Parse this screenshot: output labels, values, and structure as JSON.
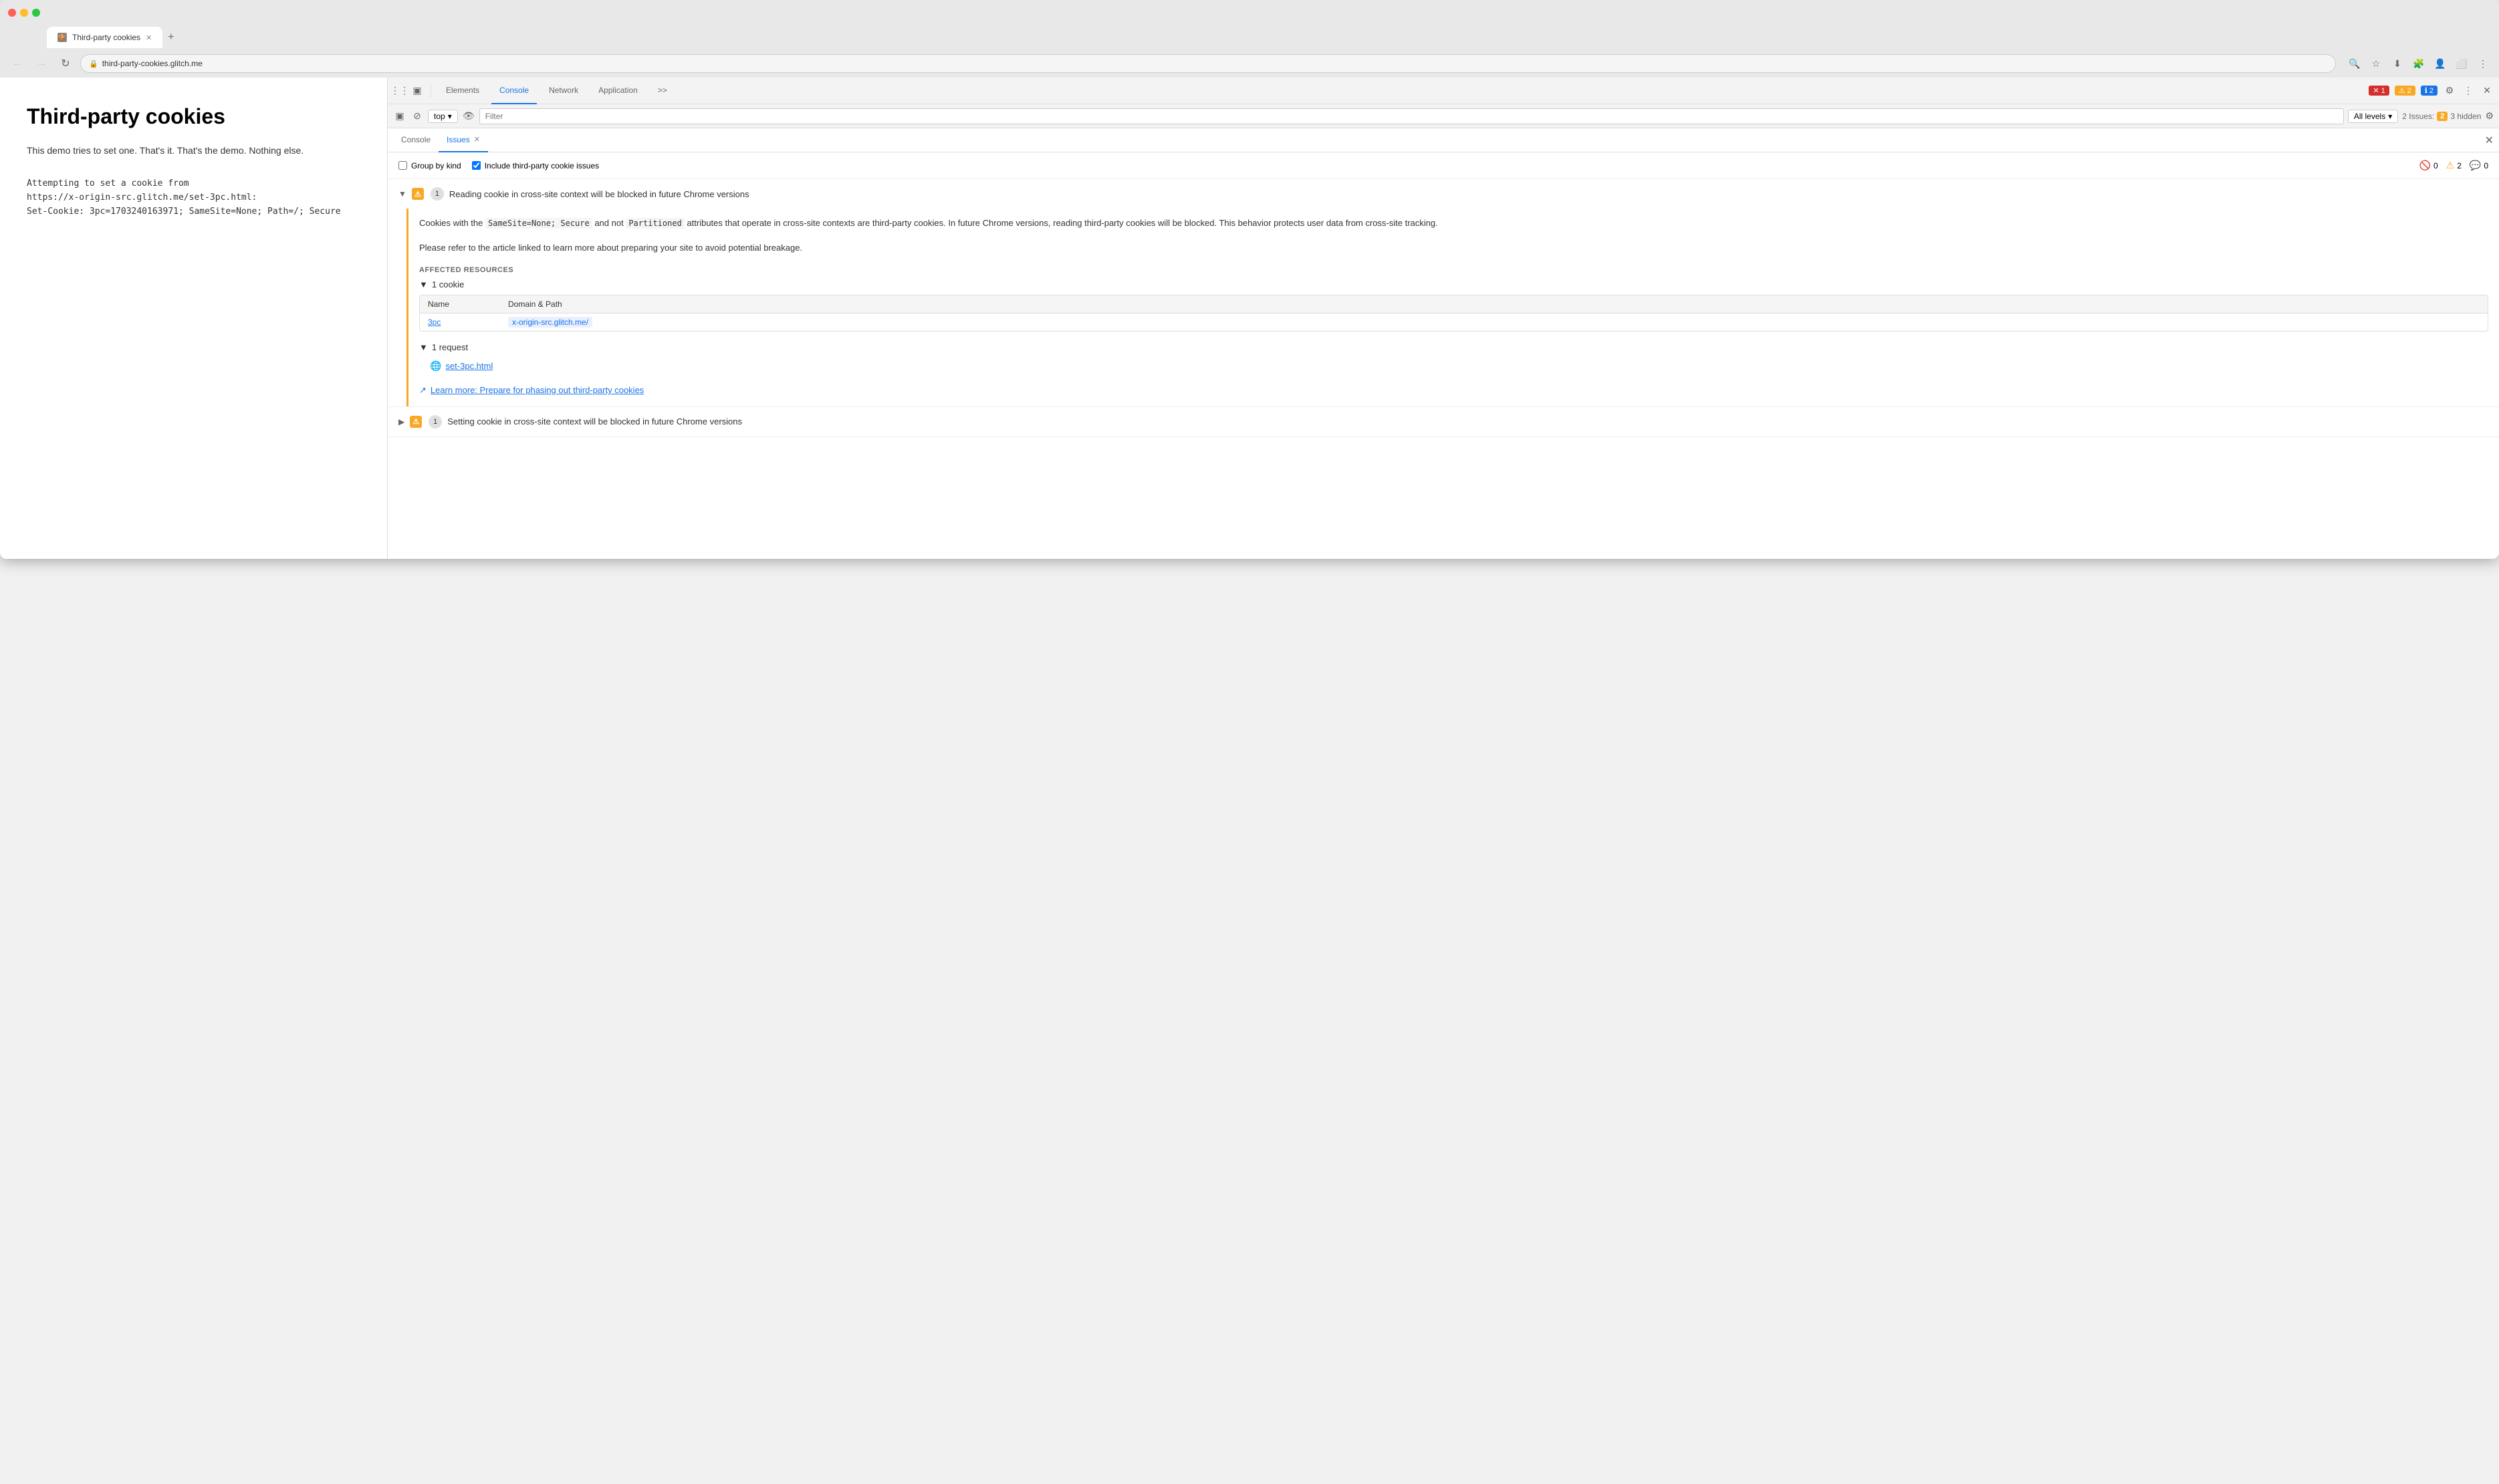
{
  "browser": {
    "tab_title": "Third-party cookies",
    "tab_favicon": "🍪",
    "url": "third-party-cookies.glitch.me",
    "new_tab_label": "+"
  },
  "page": {
    "title": "Third-party cookies",
    "description": "This demo tries to set one. That's it. That's the demo. Nothing else.",
    "attempting_label": "Attempting to set a cookie from",
    "cookie_url": "https://x-origin-src.glitch.me/set-3pc.html:",
    "set_cookie_line": "Set-Cookie: 3pc=1703240163971; SameSite=None; Path=/; Secure"
  },
  "devtools": {
    "toolbar": {
      "inspect_icon": "⋮⋮",
      "device_icon": "▣",
      "elements_label": "Elements",
      "console_label": "Console",
      "network_label": "Network",
      "application_label": "Application",
      "more_label": ">>",
      "error_count": "1",
      "warning_count": "2",
      "info_count": "2",
      "settings_icon": "⚙",
      "more_options_icon": "⋮",
      "close_icon": "✕"
    },
    "toolbar2": {
      "sidebar_icon": "▣",
      "block_icon": "⊘",
      "top_label": "top",
      "dropdown_icon": "▾",
      "eye_icon": "👁",
      "filter_placeholder": "Filter",
      "levels_label": "All levels",
      "levels_icon": "▾",
      "issues_label": "2 Issues:",
      "issues_count": "2",
      "hidden_count": "3 hidden",
      "settings_icon": "⚙"
    },
    "panel": {
      "console_label": "Console",
      "issues_label": "Issues",
      "close_label": "✕",
      "group_by_kind_label": "Group by kind",
      "include_third_party_label": "Include third-party cookie issues",
      "error_count": "0",
      "warning_count": "2",
      "info_count": "0"
    },
    "issues": [
      {
        "id": 1,
        "expanded": true,
        "badge_type": "warning",
        "count": 1,
        "title": "Reading cookie in cross-site context will be blocked in future Chrome versions",
        "description_parts": [
          "Cookies with the ",
          "SameSite=None; Secure",
          " and not ",
          "Partitioned",
          " attributes that operate in cross-site contexts are third-party cookies. In future Chrome versions, reading third-party cookies will be blocked. This behavior protects user data from cross-site tracking."
        ],
        "description2": "Please refer to the article linked to learn more about preparing your site to avoid potential breakage.",
        "affected_resources_title": "AFFECTED RESOURCES",
        "cookies_expand": "1 cookie",
        "cookies_table": {
          "headers": [
            "Name",
            "Domain & Path"
          ],
          "rows": [
            {
              "name": "3pc",
              "domain": "x-origin-src.glitch.me/"
            }
          ]
        },
        "request_expand": "1 request",
        "request_item": "set-3pc.html",
        "learn_more_text": "Learn more: Prepare for phasing out third-party cookies",
        "learn_more_url": "#"
      },
      {
        "id": 2,
        "expanded": false,
        "badge_type": "warning",
        "count": 1,
        "title": "Setting cookie in cross-site context will be blocked in future Chrome versions"
      }
    ]
  }
}
